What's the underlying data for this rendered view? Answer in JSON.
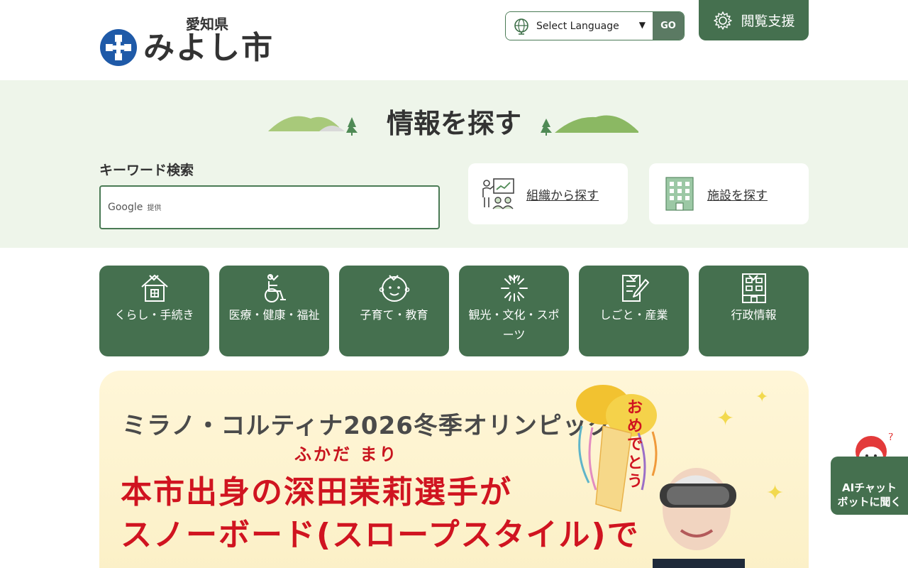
{
  "header": {
    "prefecture": "愛知県",
    "city": "みよし市",
    "language": {
      "selected": "Select Language",
      "go_label": "GO"
    },
    "assist_label": "閲覧支援"
  },
  "search": {
    "title": "情報を探す",
    "keyword_label": "キーワード検索",
    "google_label": "Google",
    "google_sub": "提供",
    "cards": [
      {
        "label": "組織から探す"
      },
      {
        "label": "施設を探す"
      }
    ]
  },
  "categories": [
    {
      "label": "くらし・手続き"
    },
    {
      "label": "医療・健康・福祉"
    },
    {
      "label": "子育て・教育"
    },
    {
      "label": "観光・文化・スポーツ"
    },
    {
      "label": "しごと・産業"
    },
    {
      "label": "行政情報"
    }
  ],
  "hero": {
    "line1": "ミラノ・コルティナ2026冬季オリンピック",
    "ruby": "ふかだ まり",
    "line2": "本市出身の深田茉莉選手が",
    "line3": "スノーボード(スロープスタイル)で",
    "balloon_text": "おめでとう"
  },
  "ai_chat": {
    "line1": "AIチャット",
    "line2": "ボットに聞く"
  },
  "colors": {
    "brand_green": "#45704f",
    "band_bg": "#eef5ea",
    "hero_red": "#d01420"
  }
}
